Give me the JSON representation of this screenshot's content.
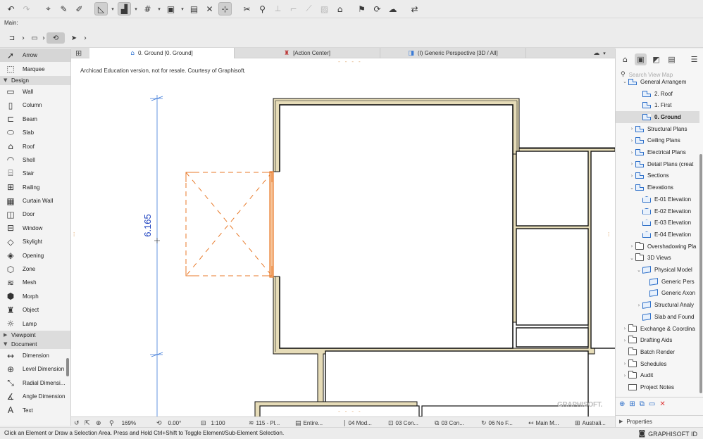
{
  "toolbar": {
    "icons": [
      "undo-icon",
      "redo-icon",
      "pick-up-icon",
      "inject-icon",
      "eyedropper-icon",
      "snap-guides-icon",
      "gravity-icon",
      "grid-snap-icon",
      "layer-icon",
      "suspend-groups-icon",
      "trace-icon",
      "select-tool-icon",
      "scissors-icon",
      "magic-wand-icon",
      "rotate-icon",
      "mirror-icon",
      "adjust-icon",
      "image-icon",
      "home-icon",
      "flag-icon",
      "refresh-icon",
      "cloud-icon",
      "teamwork-icon"
    ]
  },
  "infobox": {
    "label": "Main:"
  },
  "toolbox": {
    "arrow": "Arrow",
    "marquee": "Marquee",
    "design_header": "Design",
    "design_tools": [
      "Wall",
      "Column",
      "Beam",
      "Slab",
      "Roof",
      "Shell",
      "Stair",
      "Railing",
      "Curtain Wall",
      "Door",
      "Window",
      "Skylight",
      "Opening",
      "Zone",
      "Mesh",
      "Morph",
      "Object",
      "Lamp"
    ],
    "viewpoint_header": "Viewpoint",
    "document_header": "Document",
    "document_tools": [
      "Dimension",
      "Level Dimension",
      "Radial Dimensi...",
      "Angle Dimension",
      "Text"
    ]
  },
  "tabs": [
    {
      "label": "0. Ground [0. Ground]",
      "icon": "floor-plan-icon",
      "active": true
    },
    {
      "label": "[Action Center]",
      "icon": "action-center-icon",
      "active": false
    },
    {
      "label": "(I) Generic Perspective [3D / All]",
      "icon": "3d-view-icon",
      "active": false
    }
  ],
  "canvas": {
    "watermark": "Archicad Education version, not for resale. Courtesy of Graphisoft.",
    "dimension_value": "6.165",
    "brand_watermark": "GRAPHISOFT."
  },
  "bottombar": {
    "zoom": "169%",
    "angle": "0.00°",
    "scale": "1:100",
    "layer_combo": "115 - Pl...",
    "structure": "Entire...",
    "pen_set": "04 Mod...",
    "model_view": "03 Con...",
    "graphic_override": "03 Con...",
    "renovation": "06 No F...",
    "dimension": "Main M...",
    "language": "Australi..."
  },
  "status": {
    "text": "Click an Element or Draw a Selection Area. Press and Hold Ctrl+Shift to Toggle Element/Sub-Element Selection.",
    "id_label": "GRAPHISOFT ID"
  },
  "navigator": {
    "search_placeholder": "Search View Map",
    "nodes": [
      {
        "label": "General Arrangem",
        "icon": "plan",
        "indent": 1,
        "arrow": "down"
      },
      {
        "label": "2. Roof",
        "icon": "plan",
        "indent": 3,
        "arrow": ""
      },
      {
        "label": "1. First",
        "icon": "plan",
        "indent": 3,
        "arrow": ""
      },
      {
        "label": "0. Ground",
        "icon": "plan",
        "indent": 3,
        "arrow": "",
        "selected": true
      },
      {
        "label": "Structural Plans",
        "icon": "plan",
        "indent": 2,
        "arrow": "right"
      },
      {
        "label": "Ceiling Plans",
        "icon": "plan",
        "indent": 2,
        "arrow": "right"
      },
      {
        "label": "Electrical Plans",
        "icon": "plan",
        "indent": 2,
        "arrow": "right"
      },
      {
        "label": "Detail Plans (creat",
        "icon": "plan",
        "indent": 2,
        "arrow": "right"
      },
      {
        "label": "Sections",
        "icon": "plan",
        "indent": 2,
        "arrow": "right"
      },
      {
        "label": "Elevations",
        "icon": "plan",
        "indent": 2,
        "arrow": "down"
      },
      {
        "label": "E-01 Elevation",
        "icon": "elev",
        "indent": 3,
        "arrow": ""
      },
      {
        "label": "E-02 Elevation",
        "icon": "elev",
        "indent": 3,
        "arrow": ""
      },
      {
        "label": "E-03 Elevation",
        "icon": "elev",
        "indent": 3,
        "arrow": ""
      },
      {
        "label": "E-04 Elevation",
        "icon": "elev",
        "indent": 3,
        "arrow": ""
      },
      {
        "label": "Overshadowing Pla",
        "icon": "folder",
        "indent": 2,
        "arrow": "right"
      },
      {
        "label": "3D Views",
        "icon": "folder",
        "indent": 2,
        "arrow": "down"
      },
      {
        "label": "Physical Model",
        "icon": "cube",
        "indent": 3,
        "arrow": "down"
      },
      {
        "label": "Generic Pers",
        "icon": "cube",
        "indent": 4,
        "arrow": ""
      },
      {
        "label": "Generic Axon",
        "icon": "cube",
        "indent": 4,
        "arrow": ""
      },
      {
        "label": "Structural Analy",
        "icon": "cube",
        "indent": 3,
        "arrow": "right"
      },
      {
        "label": "Slab and Found",
        "icon": "cube",
        "indent": 3,
        "arrow": ""
      },
      {
        "label": "Exchange & Coordina",
        "icon": "folder",
        "indent": 1,
        "arrow": "right"
      },
      {
        "label": "Drafting Aids",
        "icon": "folder",
        "indent": 1,
        "arrow": "right"
      },
      {
        "label": "Batch Render",
        "icon": "folder",
        "indent": 1,
        "arrow": ""
      },
      {
        "label": "Schedules",
        "icon": "folder",
        "indent": 1,
        "arrow": "right"
      },
      {
        "label": "Audit",
        "icon": "folder",
        "indent": 1,
        "arrow": "right"
      },
      {
        "label": "Project Notes",
        "icon": "doc",
        "indent": 1,
        "arrow": ""
      }
    ],
    "properties_label": "Properties"
  },
  "colors": {
    "wall_fill": "#e6dcb8",
    "selection_orange": "#e87a2a",
    "dimension_blue": "#3b78d8",
    "dimension_text": "#1a3fbf"
  }
}
